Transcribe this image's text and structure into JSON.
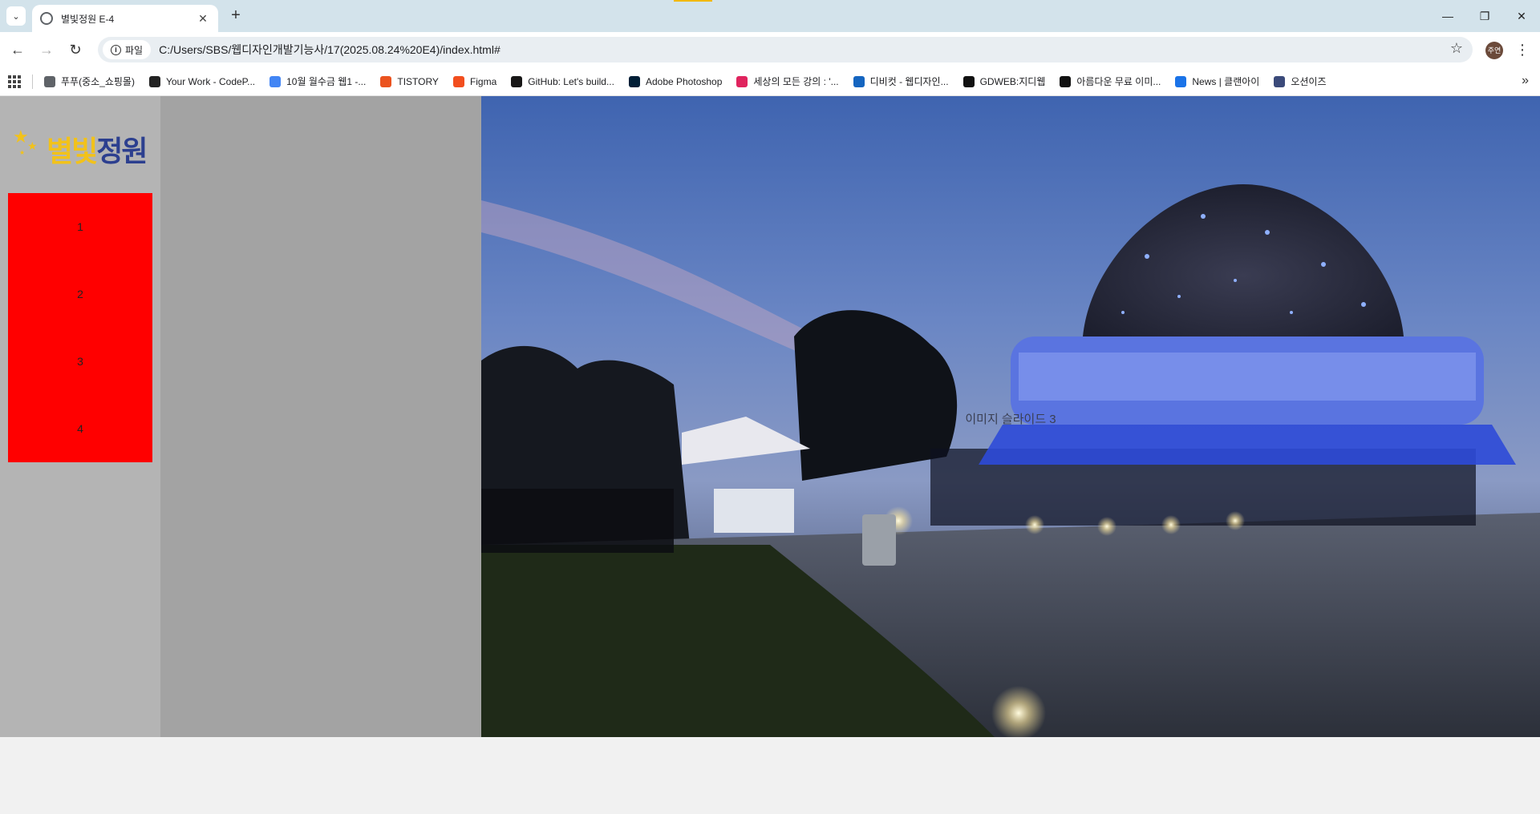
{
  "browser": {
    "tab_title": "별빛정원 E-4",
    "site_chip": "파일",
    "url": "C:/Users/SBS/웹디자인개발기능사/17(2025.08.24%20E4)/index.html#",
    "profile_initials": "주연",
    "bookmarks": [
      {
        "label": "푸푸(중소_쇼핑몰)",
        "icon": "folder-icon",
        "color": "#5f6368"
      },
      {
        "label": "Your Work - CodeP...",
        "icon": "codepen-icon",
        "color": "#222222"
      },
      {
        "label": "10월 월수금 웹1 -...",
        "icon": "docs-icon",
        "color": "#4285f4"
      },
      {
        "label": "TISTORY",
        "icon": "tistory-icon",
        "color": "#eb531f"
      },
      {
        "label": "Figma",
        "icon": "figma-icon",
        "color": "#f24e1e"
      },
      {
        "label": "GitHub: Let's build...",
        "icon": "github-icon",
        "color": "#181717"
      },
      {
        "label": "Adobe Photoshop",
        "icon": "photoshop-icon",
        "color": "#001e36"
      },
      {
        "label": "세상의 모든 강의 : '...",
        "icon": "play-icon",
        "color": "#e0245e"
      },
      {
        "label": "디비컷 - 웹디자인...",
        "icon": "dbcut-icon",
        "color": "#1565c0"
      },
      {
        "label": "GDWEB:지디웹",
        "icon": "tiktok-icon",
        "color": "#111111"
      },
      {
        "label": "아름다운 무료 이미...",
        "icon": "unsplash-icon",
        "color": "#111111"
      },
      {
        "label": "News | 클랜아이",
        "icon": "info-icon",
        "color": "#1a73e8"
      },
      {
        "label": "오션이즈",
        "icon": "oceanis-icon",
        "color": "#3b4a7a"
      }
    ]
  },
  "page": {
    "logo": {
      "part1": "별빛",
      "part2": "정원"
    },
    "menu": [
      {
        "label": "1"
      },
      {
        "label": "2"
      },
      {
        "label": "3"
      },
      {
        "label": "4"
      }
    ],
    "slide_caption": "이미지 슬라이드 3"
  }
}
